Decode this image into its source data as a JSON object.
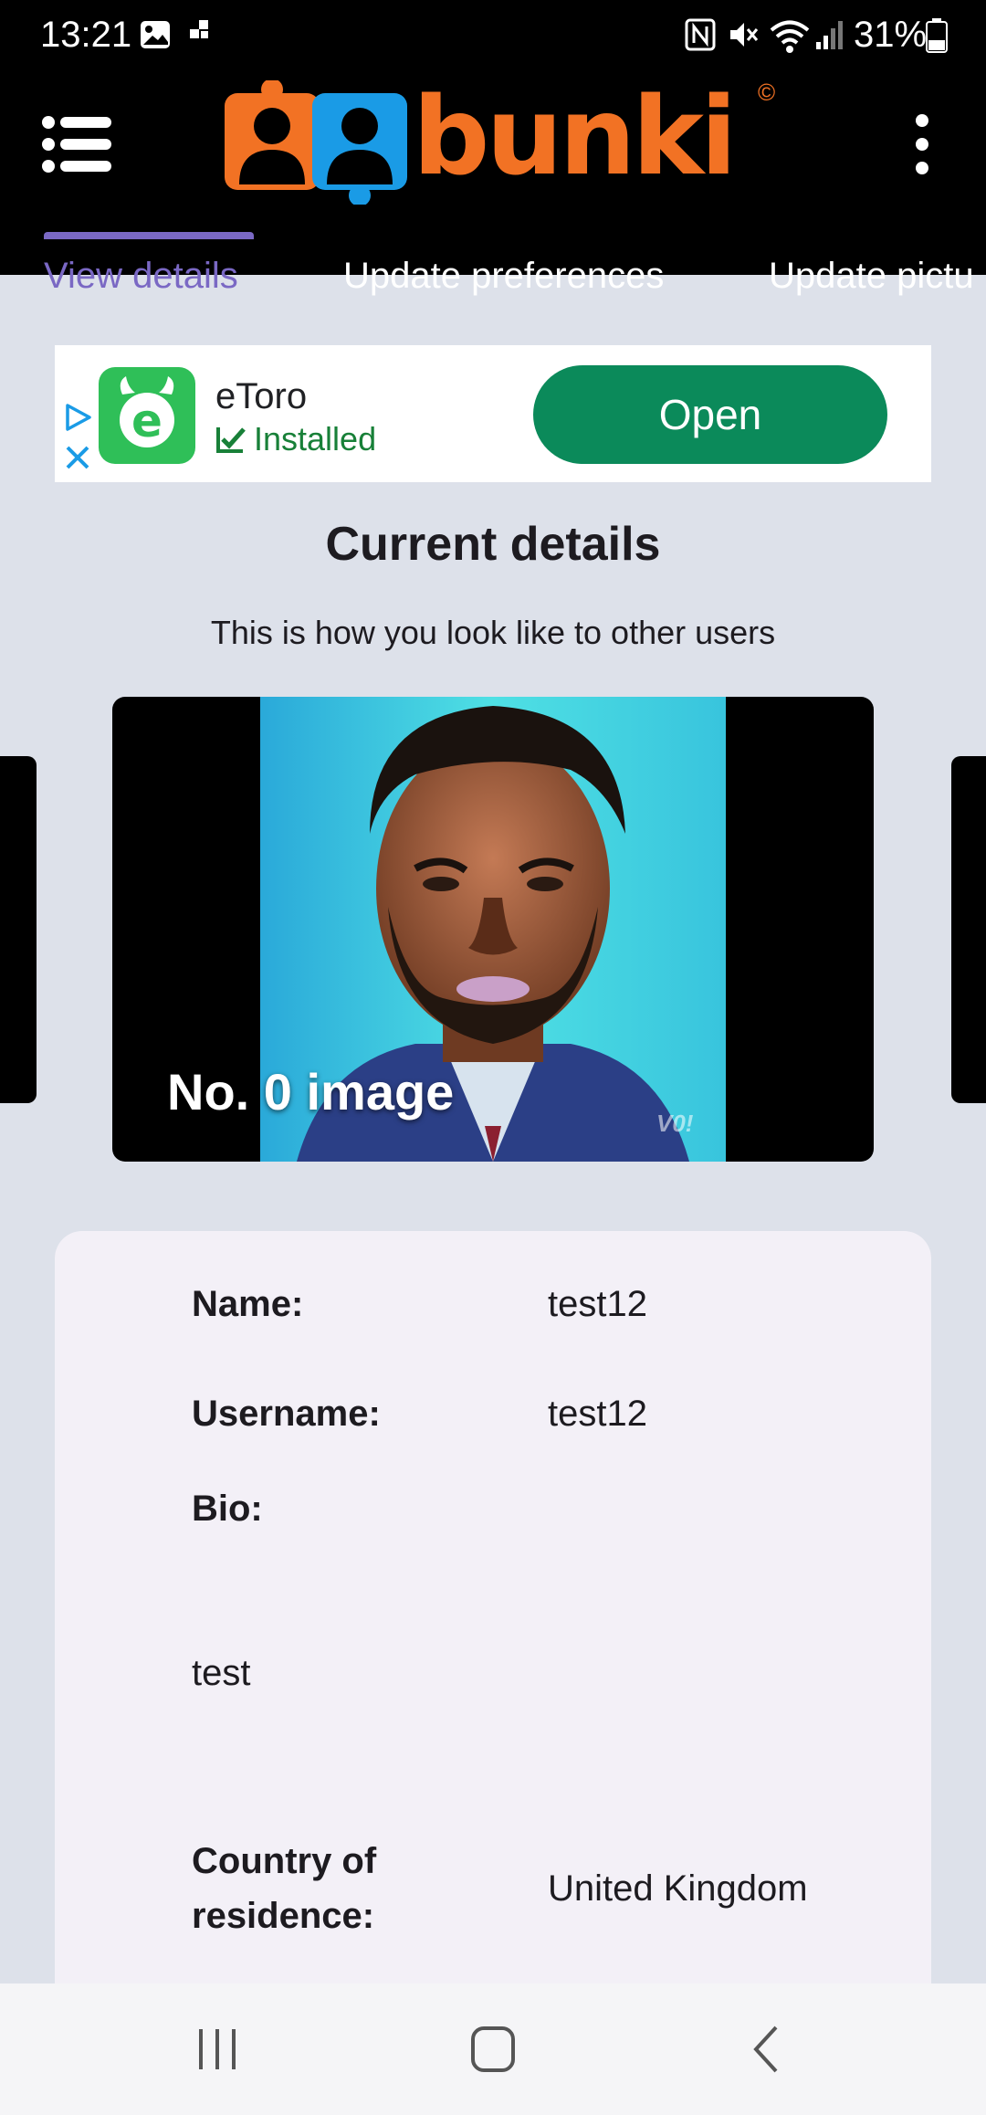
{
  "status_bar": {
    "time": "13:21",
    "battery_percent": "31%"
  },
  "app": {
    "logo_text": "bunki",
    "logo_symbol": "©",
    "accent_color": "#7a68c4",
    "brand_orange": "#f27224",
    "brand_blue": "#1a9be6"
  },
  "tabs": [
    {
      "label": "View details",
      "active": true
    },
    {
      "label": "Update preferences",
      "active": false
    },
    {
      "label": "Update pictu",
      "active": false
    }
  ],
  "ad": {
    "app_name": "eToro",
    "status": "Installed",
    "button_label": "Open",
    "icon_letter": "e"
  },
  "content": {
    "title": "Current details",
    "subtitle": "This is how you look like to other users",
    "photo_caption": "No. 0 image",
    "watermark": "V0!"
  },
  "details": {
    "name_label": "Name:",
    "name_value": "test12",
    "username_label": "Username:",
    "username_value": "test12",
    "bio_label": "Bio:",
    "bio_value": "test",
    "country_label_line1": "Country of",
    "country_label_line2": "residence:",
    "country_value": "United Kingdom"
  }
}
